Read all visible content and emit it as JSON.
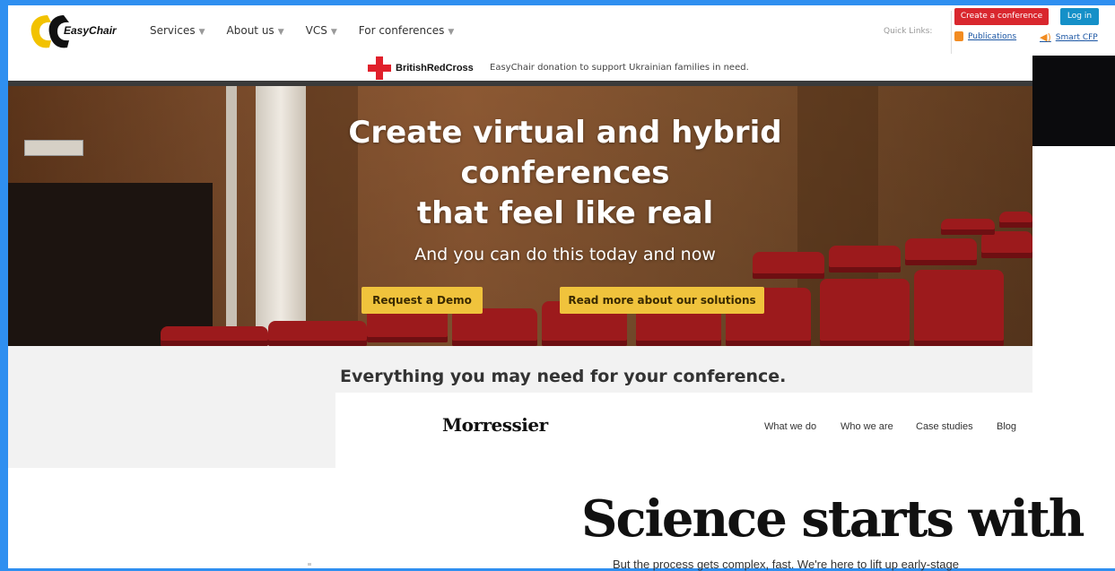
{
  "header": {
    "logo_text": "EasyChair",
    "nav": [
      {
        "label": "Services"
      },
      {
        "label": "About us"
      },
      {
        "label": "VCS"
      },
      {
        "label": "For conferences"
      }
    ],
    "quick_links_label": "Quick Links:",
    "create_conference_label": "Create a conference",
    "login_label": "Log in",
    "publications_label": "Publications",
    "smart_cfp_label": "Smart CFP"
  },
  "donation": {
    "org_name": "BritishRedCross",
    "message": "EasyChair donation to support Ukrainian families in need."
  },
  "hero": {
    "title_line1": "Create virtual and hybrid",
    "title_line2": "conferences",
    "title_line3": "that feel like real",
    "subtitle": "And you can do this today and now",
    "demo_button": "Request a Demo",
    "solutions_button": "Read more about our solutions"
  },
  "section": {
    "heading": "Everything you may need for your conference."
  },
  "morressier": {
    "logo": "Morressier",
    "nav": [
      "What we do",
      "Who we are",
      "Case studies",
      "Blog"
    ],
    "headline": "Science starts with",
    "subline": "But the process gets complex, fast. We're here to lift up early-stage"
  },
  "colors": {
    "page_background": "#2f8ff0",
    "create_button": "#d9272e",
    "login_button": "#1590c8",
    "hero_button": "#f0c33c",
    "red_cross": "#e0202b"
  }
}
